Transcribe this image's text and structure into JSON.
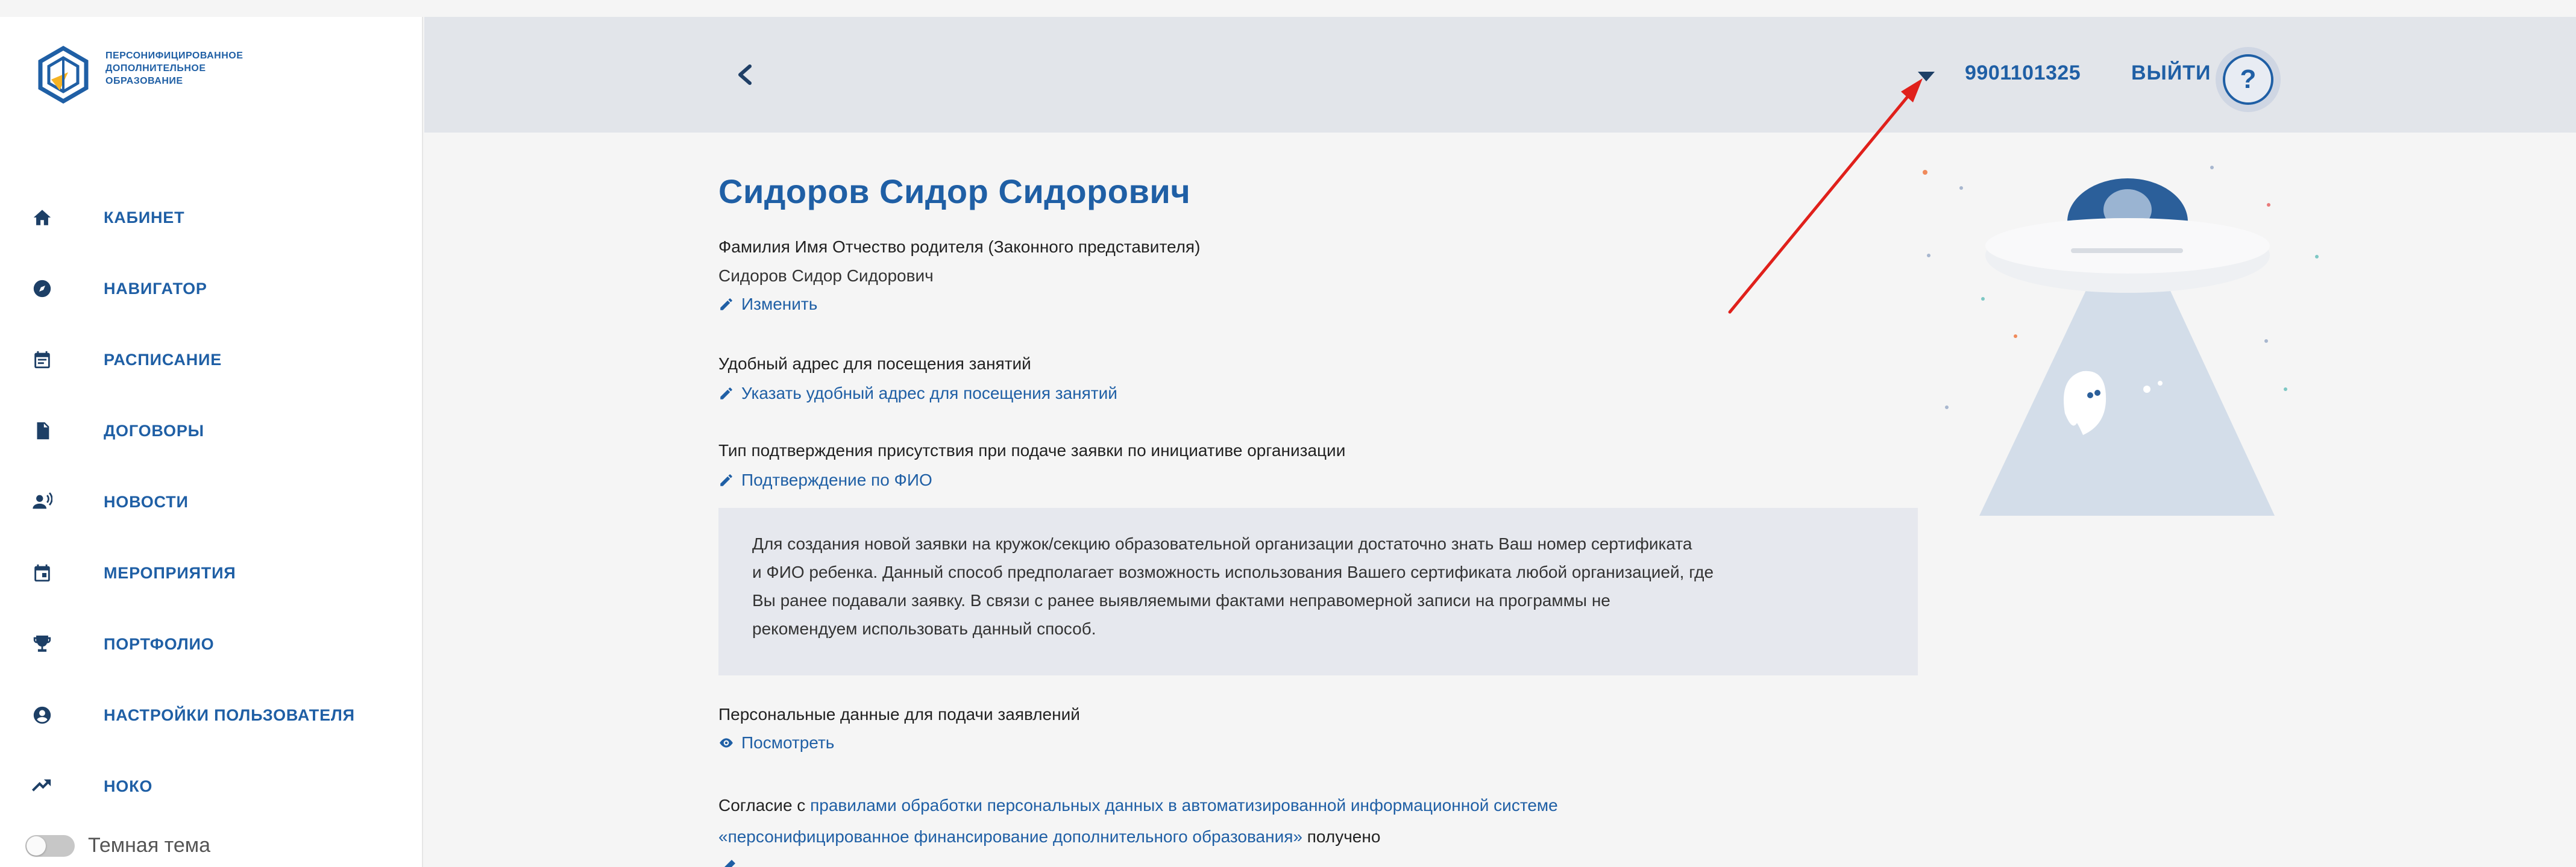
{
  "sidebar": {
    "logo_text": [
      "ПЕРСОНИФИЦИРОВАННОЕ",
      "ДОПОЛНИТЕЛЬНОЕ",
      "ОБРАЗОВАНИЕ"
    ],
    "items": [
      {
        "label": "КАБИНЕТ",
        "icon": "home-icon"
      },
      {
        "label": "НАВИГАТОР",
        "icon": "compass-icon"
      },
      {
        "label": "РАСПИСАНИЕ",
        "icon": "schedule-icon"
      },
      {
        "label": "ДОГОВОРЫ",
        "icon": "document-icon"
      },
      {
        "label": "НОВОСТИ",
        "icon": "news-icon"
      },
      {
        "label": "МЕРОПРИЯТИЯ",
        "icon": "calendar-icon"
      },
      {
        "label": "ПОРТФОЛИО",
        "icon": "trophy-icon"
      },
      {
        "label": "НАСТРОЙКИ ПОЛЬЗОВАТЕЛЯ",
        "icon": "user-settings-icon"
      },
      {
        "label": "НОКО",
        "icon": "trend-icon"
      }
    ],
    "theme_label": "Темная тема"
  },
  "header": {
    "account_number": "9901101325",
    "logout_label": "ВЫЙТИ",
    "help_label": "?"
  },
  "profile": {
    "name": "Сидоров Сидор Сидорович",
    "parent_label": "Фамилия Имя Отчество родителя (Законного представителя)",
    "parent_value": "Сидоров Сидор Сидорович",
    "edit_link": "Изменить",
    "address_label": "Удобный адрес для посещения занятий",
    "address_link": "Указать удобный адрес для посещения занятий",
    "confirm_label": "Тип подтверждения присутствия при подаче заявки по инициативе организации",
    "confirm_link": "Подтверждение по ФИО",
    "notice_lines": [
      "Для создания новой заявки на кружок/секцию образовательной организации достаточно знать Ваш номер сертификата",
      "и ФИО ребенка. Данный способ предполагает возможность использования Вашего сертификата любой организацией, где",
      "Вы ранее подавали заявку. В связи с ранее выявляемыми фактами неправомерной записи на программы не",
      "рекомендуем использовать данный способ."
    ],
    "personal_data_label": "Персональные данные для подачи заявлений",
    "personal_data_link": "Посмотреть",
    "consent_prefix": "Согласие с ",
    "consent_link_1": "правилами обработки персональных данных в автоматизированной информационной системе",
    "consent_link_2": "«персонифицированное финансирование дополнительного образования»",
    "consent_suffix": " получено"
  },
  "colors": {
    "accent": "#1f5fa5",
    "header_bg": "#e2e5ea",
    "notice_bg": "#e6e8ee",
    "annotation_arrow": "#e0201b"
  }
}
